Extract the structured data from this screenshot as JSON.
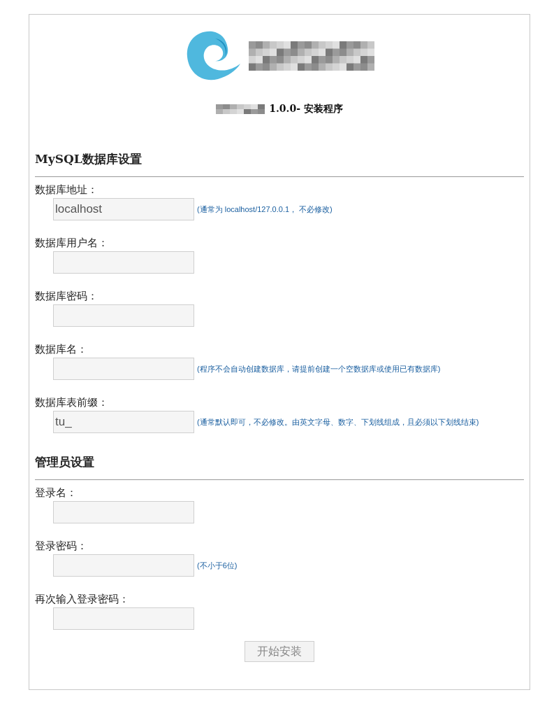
{
  "subtitle": "1.0.0- 安装程序",
  "sections": [
    {
      "title": "MySQL数据库设置",
      "fields": [
        {
          "label": "数据库地址：",
          "value": "localhost",
          "hint": "(通常为 localhost/127.0.0.1， 不必修改)"
        },
        {
          "label": "数据库用户名："
        },
        {
          "label": "数据库密码："
        },
        {
          "label": "数据库名：",
          "hint": "(程序不会自动创建数据库，请提前创建一个空数据库或使用已有数据库)"
        },
        {
          "label": "数据库表前缀：",
          "value": "tu_",
          "hint": "(通常默认即可，不必修改。由英文字母、数字、下划线组成，且必须以下划线结束)"
        }
      ]
    },
    {
      "title": "管理员设置",
      "fields": [
        {
          "label": "登录名："
        },
        {
          "label": "登录密码：",
          "hint": "(不小于6位)"
        },
        {
          "label": "再次输入登录密码："
        }
      ]
    }
  ],
  "submit": "开始安装"
}
